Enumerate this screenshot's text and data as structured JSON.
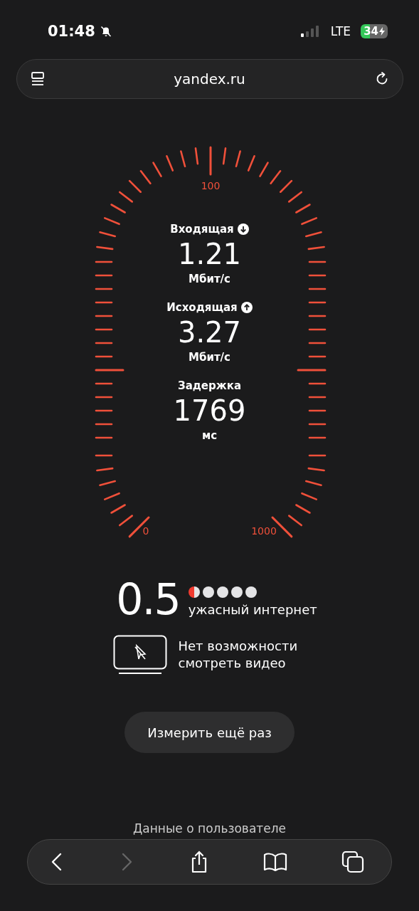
{
  "status_bar": {
    "time": "01:48",
    "network": "LTE",
    "battery": "34",
    "charging": true,
    "silent": true
  },
  "address_bar": {
    "url": "yandex.ru"
  },
  "gauge": {
    "top_label": "100",
    "min_label": "0",
    "max_label": "1000"
  },
  "metrics": [
    {
      "label": "Входящая",
      "kind": "download",
      "value": "1.21",
      "unit": "Мбит/с"
    },
    {
      "label": "Исходящая",
      "kind": "upload",
      "value": "3.27",
      "unit": "Мбит/с"
    },
    {
      "label": "Задержка",
      "kind": "latency",
      "value": "1769",
      "unit": "мс"
    }
  ],
  "rating": {
    "score": "0.5",
    "stars": 0.5,
    "verdict": "ужасный интернет"
  },
  "video_note": {
    "text": "Нет возможности смотреть видео"
  },
  "retry_button": {
    "label": "Измерить ещё раз"
  },
  "footer": {
    "text": "Данные о пользователе"
  },
  "toolbar": [
    {
      "kind": "back",
      "disabled": false
    },
    {
      "kind": "forward",
      "disabled": true
    },
    {
      "kind": "share",
      "disabled": false
    },
    {
      "kind": "bookmarks",
      "disabled": false
    },
    {
      "kind": "tabs",
      "disabled": false
    }
  ]
}
